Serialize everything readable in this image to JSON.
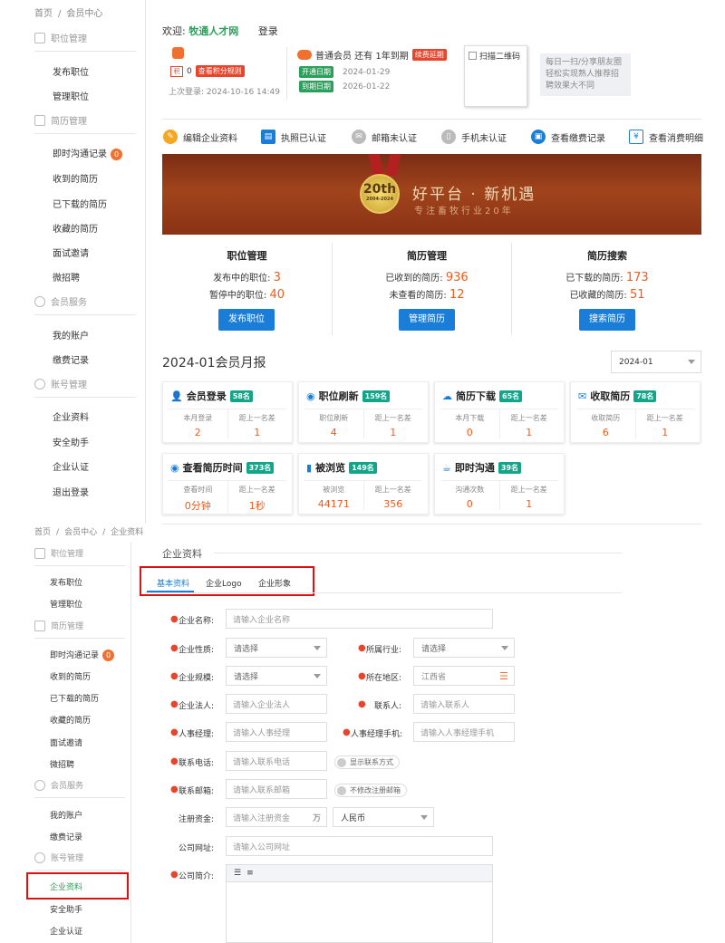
{
  "breadcrumb_top": [
    "首页",
    "会员中心"
  ],
  "breadcrumb_bottom": [
    "首页",
    "会员中心",
    "企业资料"
  ],
  "sidebar": {
    "sections": [
      {
        "title": "职位管理",
        "items": [
          "发布职位",
          "管理职位"
        ]
      },
      {
        "title": "简历管理",
        "items": [
          "即时沟通记录",
          "收到的简历",
          "已下载的简历",
          "收藏的简历",
          "面试邀请",
          "微招聘"
        ]
      },
      {
        "title": "会员服务",
        "items": [
          "我的账户",
          "缴费记录"
        ]
      },
      {
        "title": "账号管理",
        "items": [
          "企业资料",
          "安全助手",
          "企业认证",
          "退出登录"
        ]
      }
    ],
    "chat_badge": "0"
  },
  "sidebar2": {
    "sections": [
      {
        "title": "职位管理",
        "items": [
          "发布职位",
          "管理职位"
        ]
      },
      {
        "title": "简历管理",
        "items": [
          "即时沟通记录",
          "收到的简历",
          "已下载的简历",
          "收藏的简历",
          "面试邀请",
          "微招聘"
        ]
      },
      {
        "title": "会员服务",
        "items": [
          "我的账户",
          "缴费记录"
        ]
      },
      {
        "title": "账号管理",
        "items": [
          "企业资料",
          "安全助手",
          "企业认证"
        ]
      }
    ],
    "chat_badge": "0"
  },
  "header": {
    "welcome": "欢迎:",
    "company": "牧通人才网",
    "login": "登录",
    "points": "0",
    "points_rule": "查看积分规则",
    "last_login": "上次登录:  2024-10-16 14:49",
    "member_text": "普通会员 还有 1年到期",
    "renew": "续费延期",
    "open_label": "开通日期",
    "open_date": "2024-01-29",
    "expire_label": "到期日期",
    "expire_date": "2026-01-22",
    "qr_label": "扫描二维码",
    "tip": "每日一扫/分享朋友圈 轻松实现熟人推荐招聘效果大不同"
  },
  "quicklinks": [
    "编辑企业资料",
    "执照已认证",
    "邮箱未认证",
    "手机未认证",
    "查看缴费记录",
    "查看消费明细"
  ],
  "banner": {
    "medal_top": "20th",
    "medal_bottom": "2004-2024",
    "headline": "好平台 · 新机遇",
    "sub": "专注畜牧行业20年"
  },
  "stats": [
    {
      "title": "职位管理",
      "lines": [
        {
          "label": "发布中的职位:",
          "value": "3"
        },
        {
          "label": "暂停中的职位:",
          "value": "40"
        }
      ],
      "button": "发布职位"
    },
    {
      "title": "简历管理",
      "lines": [
        {
          "label": "已收到的简历:",
          "value": "936"
        },
        {
          "label": "未查看的简历:",
          "value": "12"
        }
      ],
      "button": "管理简历"
    },
    {
      "title": "简历搜索",
      "lines": [
        {
          "label": "已下载的简历:",
          "value": "173"
        },
        {
          "label": "已收藏的简历:",
          "value": "51"
        }
      ],
      "button": "搜索简历"
    }
  ],
  "monthly": {
    "title": "2024-01会员月报",
    "select": "2024-01",
    "cards": [
      {
        "name": "会员登录",
        "rank": "58名",
        "c1": "本月登录",
        "v1": "2",
        "c2": "距上一名差",
        "v2": "1",
        "color": "#1a7ed8"
      },
      {
        "name": "职位刷新",
        "rank": "159名",
        "c1": "职位刷新",
        "v1": "4",
        "c2": "距上一名差",
        "v2": "1",
        "color": "#1a7ed8"
      },
      {
        "name": "简历下载",
        "rank": "65名",
        "c1": "本月下载",
        "v1": "0",
        "c2": "距上一名差",
        "v2": "1",
        "color": "#1a7ed8"
      },
      {
        "name": "收取简历",
        "rank": "78名",
        "c1": "收取简历",
        "v1": "6",
        "c2": "距上一名差",
        "v2": "1",
        "color": "#1a7ed8"
      },
      {
        "name": "查看简历时间",
        "rank": "373名",
        "c1": "查看时间",
        "v1": "0分钟",
        "c2": "距上一名差",
        "v2": "1秒",
        "color": "#1a7ed8"
      },
      {
        "name": "被浏览",
        "rank": "149名",
        "c1": "被浏览",
        "v1": "44171",
        "c2": "距上一名差",
        "v2": "356",
        "color": "#1a7ed8"
      },
      {
        "name": "即时沟通",
        "rank": "39名",
        "c1": "沟通次数",
        "v1": "0",
        "c2": "距上一名差",
        "v2": "1",
        "color": "#1a7ed8"
      }
    ]
  },
  "profile": {
    "title": "企业资料",
    "tabs": [
      "基本资料",
      "企业Logo",
      "企业形象"
    ],
    "fields": {
      "name_label": "企业名称:",
      "name_ph": "请输入企业名称",
      "nature_label": "企业性质:",
      "nature_val": "请选择",
      "industry_label": "所属行业:",
      "industry_val": "请选择",
      "scale_label": "企业规模:",
      "scale_val": "请选择",
      "region_label": "所在地区:",
      "region_val": "江西省",
      "legal_label": "企业法人:",
      "legal_ph": "请输入企业法人",
      "contact_label": "联系人:",
      "contact_ph": "请输入联系人",
      "hr_label": "人事经理:",
      "hr_ph": "请输入人事经理",
      "hr_phone_label": "人事经理手机:",
      "hr_phone_ph": "请输入人事经理手机",
      "tel_label": "联系电话:",
      "tel_ph": "请输入联系电话",
      "tel_toggle": "显示联系方式",
      "email_label": "联系邮箱:",
      "email_ph": "请输入联系邮箱",
      "email_toggle": "不修改注册邮箱",
      "capital_label": "注册资金:",
      "capital_ph": "请输入注册资金",
      "capital_unit": "万",
      "currency": "人民币",
      "site_label": "公司网址:",
      "site_ph": "请输入公司网址",
      "intro_label": "公司简介:"
    }
  },
  "colors": {
    "accent": "#1a7ed8",
    "brand_green": "#2aa05a",
    "highlight": "#f05a1a",
    "annotation_red": "#e01010"
  }
}
